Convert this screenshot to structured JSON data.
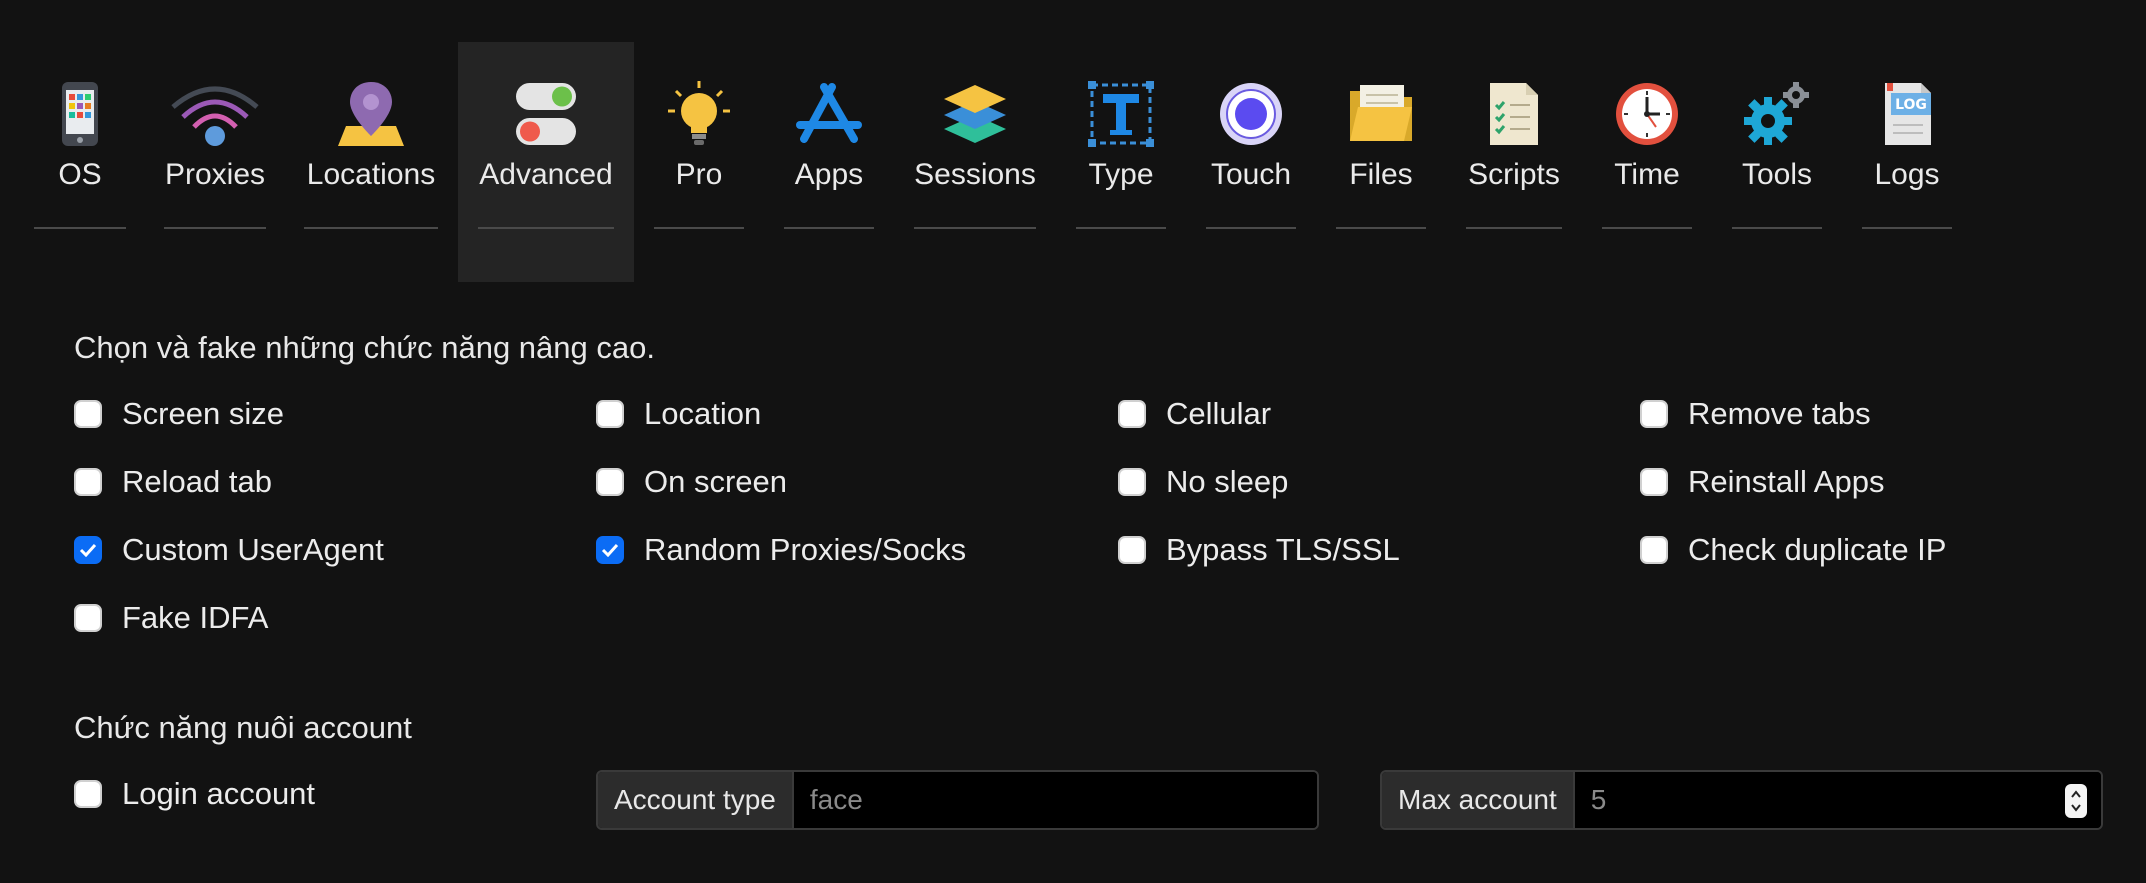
{
  "toolbar": {
    "tabs": [
      {
        "label": "OS",
        "icon": "phone-icon"
      },
      {
        "label": "Proxies",
        "icon": "wifi-icon"
      },
      {
        "label": "Locations",
        "icon": "map-pin-icon"
      },
      {
        "label": "Advanced",
        "icon": "toggle-switches-icon",
        "active": true
      },
      {
        "label": "Pro",
        "icon": "lightbulb-icon"
      },
      {
        "label": "Apps",
        "icon": "app-store-icon"
      },
      {
        "label": "Sessions",
        "icon": "layers-icon"
      },
      {
        "label": "Type",
        "icon": "text-type-icon"
      },
      {
        "label": "Touch",
        "icon": "touch-target-icon"
      },
      {
        "label": "Files",
        "icon": "folder-icon"
      },
      {
        "label": "Scripts",
        "icon": "checklist-icon"
      },
      {
        "label": "Time",
        "icon": "clock-icon"
      },
      {
        "label": "Tools",
        "icon": "gears-icon"
      },
      {
        "label": "Logs",
        "icon": "log-file-icon"
      }
    ]
  },
  "advanced": {
    "intro": "Chọn và fake những chức năng nâng cao.",
    "options": [
      {
        "label": "Screen size",
        "checked": false
      },
      {
        "label": "Location",
        "checked": false
      },
      {
        "label": "Cellular",
        "checked": false
      },
      {
        "label": "Remove tabs",
        "checked": false
      },
      {
        "label": "Reload tab",
        "checked": false
      },
      {
        "label": "On screen",
        "checked": false
      },
      {
        "label": "No sleep",
        "checked": false
      },
      {
        "label": "Reinstall Apps",
        "checked": false
      },
      {
        "label": "Custom UserAgent",
        "checked": true
      },
      {
        "label": "Random Proxies/Socks",
        "checked": true
      },
      {
        "label": "Bypass TLS/SSL",
        "checked": false
      },
      {
        "label": "Check duplicate IP",
        "checked": false
      },
      {
        "label": "Fake IDFA",
        "checked": false
      }
    ]
  },
  "account": {
    "section_title": "Chức năng nuôi account",
    "login_label": "Login account",
    "login_checked": false,
    "account_type_label": "Account type",
    "account_type_placeholder": "face",
    "max_account_label": "Max account",
    "max_account_value": "5"
  },
  "colors": {
    "background": "#121212",
    "active_tab": "#242424",
    "checkbox_checked": "#0b6cf5"
  }
}
